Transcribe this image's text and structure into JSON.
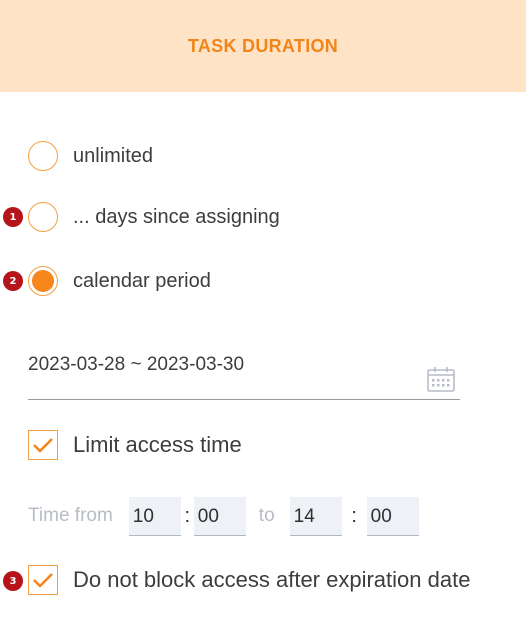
{
  "header": {
    "title": "TASK DURATION"
  },
  "duration_options": [
    {
      "label": "unlimited",
      "checked": false
    },
    {
      "label": "... days since assigning",
      "checked": false,
      "badge": "1"
    },
    {
      "label": "calendar period",
      "checked": true,
      "badge": "2"
    }
  ],
  "date_range": {
    "value": "2023-03-28 ~ 2023-03-30",
    "icon": "calendar-icon"
  },
  "limit_access": {
    "label": "Limit access time",
    "checked": true
  },
  "time": {
    "from_label": "Time from",
    "from_hour": "10",
    "from_minute": "00",
    "separator": ":",
    "to_label": "to",
    "to_hour": "14",
    "to_minute": "00"
  },
  "no_block": {
    "label": "Do not block access after expiration date",
    "checked": true,
    "badge": "3"
  },
  "colors": {
    "accent": "#f7861b",
    "header_bg": "#ffe3c6",
    "header_text": "#f0861a",
    "badge": "#b5141a"
  }
}
